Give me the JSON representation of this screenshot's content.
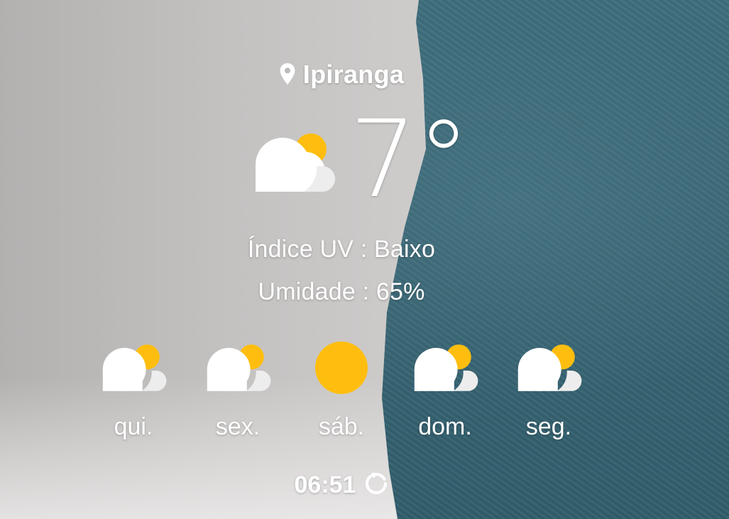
{
  "location": {
    "name": "Ipiranga",
    "icon": "location-pin-icon"
  },
  "current": {
    "temperature": "7°",
    "condition_icon": "partly-cloudy-icon"
  },
  "details": {
    "uv": "Índice UV : Baixo",
    "humidity": "Umidade : 65%"
  },
  "forecast": [
    {
      "day": "qui.",
      "icon": "partly-cloudy-icon"
    },
    {
      "day": "sex.",
      "icon": "partly-cloudy-icon"
    },
    {
      "day": "sáb.",
      "icon": "sunny-icon"
    },
    {
      "day": "dom.",
      "icon": "partly-cloudy-icon"
    },
    {
      "day": "seg.",
      "icon": "partly-cloudy-icon"
    }
  ],
  "updated": {
    "time": "06:51",
    "icon": "refresh-icon"
  },
  "colors": {
    "sun": "#FFBE0F",
    "cloud": "#FFFFFF",
    "cloud_shadow": "#EDEDED",
    "text": "#FFFFFF",
    "fabric": "#3A6776"
  }
}
